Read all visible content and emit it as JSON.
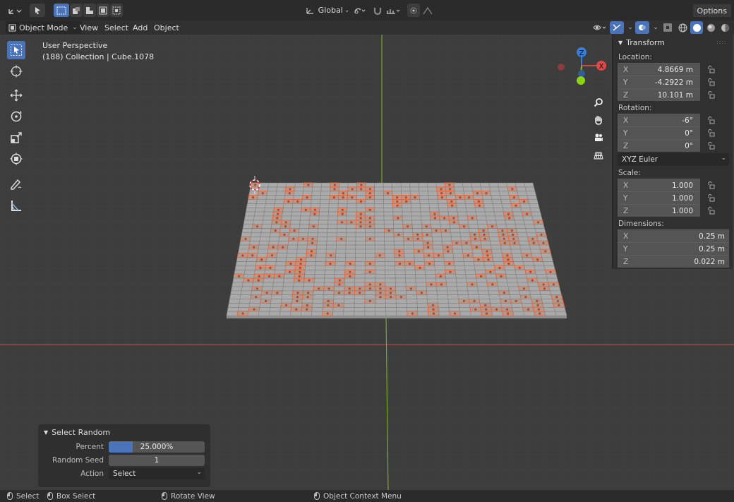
{
  "header": {
    "transform_orientation": "Global",
    "options_label": "Options"
  },
  "viewport_header": {
    "mode": "Object Mode",
    "menus": [
      "View",
      "Select",
      "Add",
      "Object"
    ]
  },
  "viewport": {
    "perspective_label": "User Perspective",
    "collection_label": "(188) Collection | Cube.1078",
    "gizmo_z_label": "Z",
    "gizmo_x_label": "X"
  },
  "transform_panel": {
    "title": "Transform",
    "location_label": "Location:",
    "location": [
      {
        "axis": "X",
        "value": "4.8669 m"
      },
      {
        "axis": "Y",
        "value": "-4.2922 m"
      },
      {
        "axis": "Z",
        "value": "10.101 m"
      }
    ],
    "rotation_label": "Rotation:",
    "rotation": [
      {
        "axis": "X",
        "value": "-6°"
      },
      {
        "axis": "Y",
        "value": "0°"
      },
      {
        "axis": "Z",
        "value": "0°"
      }
    ],
    "rotation_mode": "XYZ Euler",
    "scale_label": "Scale:",
    "scale": [
      {
        "axis": "X",
        "value": "1.000"
      },
      {
        "axis": "Y",
        "value": "1.000"
      },
      {
        "axis": "Z",
        "value": "1.000"
      }
    ],
    "dimensions_label": "Dimensions:",
    "dimensions": [
      {
        "axis": "X",
        "value": "0.25 m"
      },
      {
        "axis": "Y",
        "value": "0.25 m"
      },
      {
        "axis": "Z",
        "value": "0.022 m"
      }
    ]
  },
  "select_random": {
    "title": "Select Random",
    "percent_label": "Percent",
    "percent_value": "25.000%",
    "percent_fraction": 0.25,
    "seed_label": "Random Seed",
    "seed_value": "1",
    "action_label": "Action",
    "action_value": "Select"
  },
  "status_bar": {
    "select": "Select",
    "box_select": "Box Select",
    "rotate_view": "Rotate View",
    "context_menu": "Object Context Menu"
  },
  "colors": {
    "accent": "#4b73b9",
    "selection": "#e8643a",
    "x_axis": "#c84b4b",
    "y_axis": "#8bb630",
    "z_axis": "#3a7fd6",
    "viewport_bg": "#3d3d3d"
  }
}
